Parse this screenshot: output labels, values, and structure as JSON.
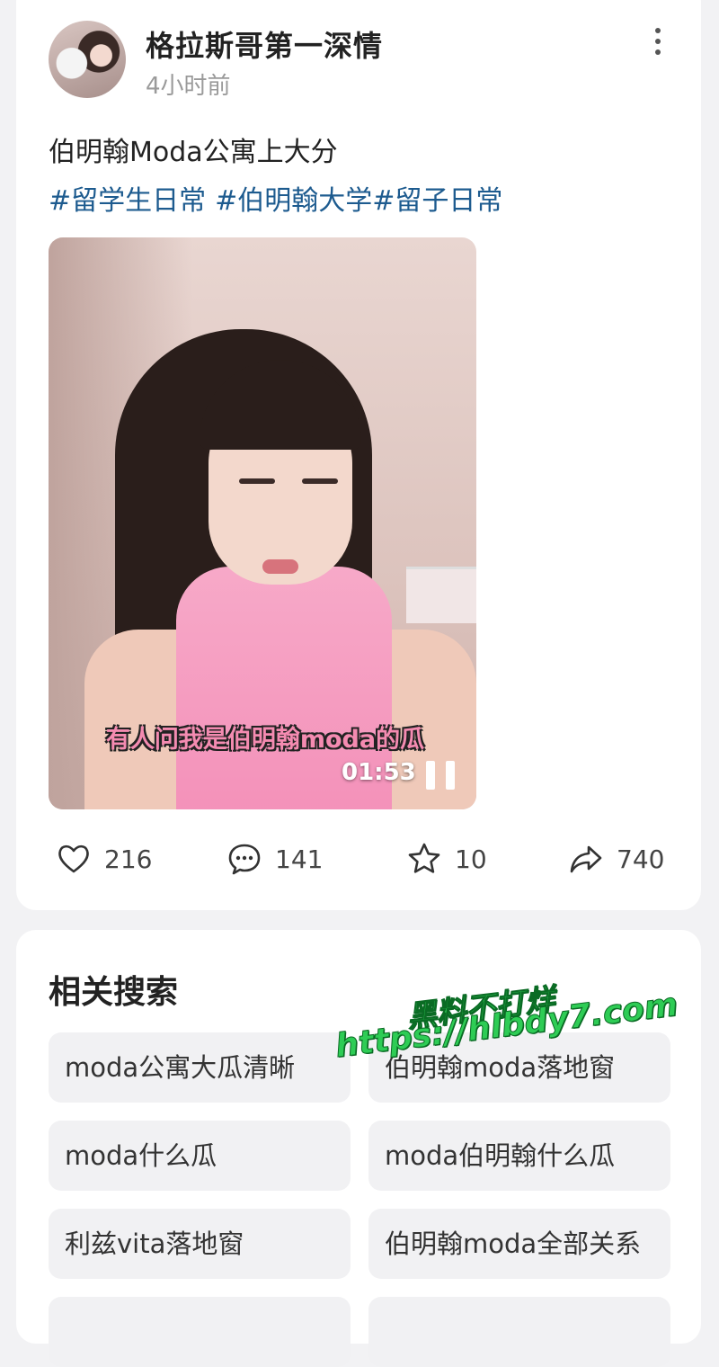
{
  "post": {
    "author": "格拉斯哥第一深情",
    "time": "4小时前",
    "text": "伯明翰Moda公寓上大分",
    "hashtags": [
      "#留学生日常",
      "#伯明翰大学",
      "#留子日常"
    ],
    "video": {
      "subtitle": "有人问我是伯明翰moda的瓜",
      "duration": "01:53",
      "state_icon": "pause-icon"
    },
    "actions": {
      "likes": "216",
      "comments": "141",
      "favorites": "10",
      "shares": "740"
    }
  },
  "related": {
    "title": "相关搜索",
    "items": [
      "moda公寓大瓜清晰",
      "伯明翰moda落地窗",
      "moda什么瓜",
      "moda伯明翰什么瓜",
      "利兹vita落地窗",
      "伯明翰moda全部关系"
    ]
  },
  "watermark": {
    "line1": "黑料不打烊",
    "line2": "https://hlbdy7.com",
    "color": "#2ecc55"
  }
}
